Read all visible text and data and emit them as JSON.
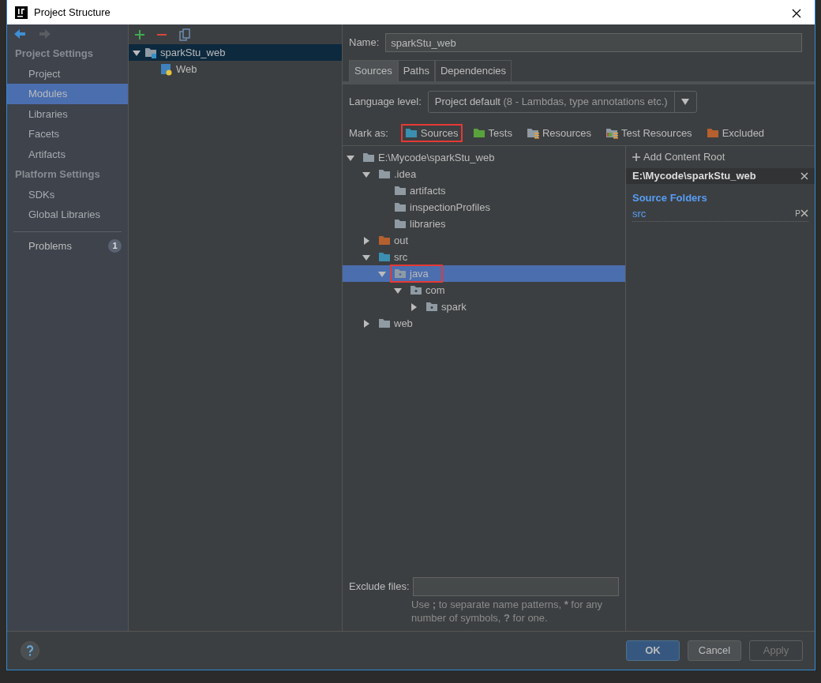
{
  "window": {
    "title": "Project Structure"
  },
  "sidebar": {
    "sections": [
      {
        "heading": "Project Settings",
        "items": [
          {
            "label": "Project",
            "selected": false
          },
          {
            "label": "Modules",
            "selected": true
          },
          {
            "label": "Libraries",
            "selected": false
          },
          {
            "label": "Facets",
            "selected": false
          },
          {
            "label": "Artifacts",
            "selected": false
          }
        ]
      },
      {
        "heading": "Platform Settings",
        "items": [
          {
            "label": "SDKs",
            "selected": false
          },
          {
            "label": "Global Libraries",
            "selected": false
          }
        ]
      }
    ],
    "problems": {
      "label": "Problems",
      "count": "1"
    }
  },
  "modules": {
    "items": [
      {
        "label": "sparkStu_web",
        "selected": true,
        "expanded": true,
        "children": [
          {
            "label": "Web",
            "selected": false
          }
        ]
      }
    ]
  },
  "name_field": {
    "label": "Name:",
    "value": "sparkStu_web"
  },
  "tabs": [
    {
      "label": "Sources",
      "selected": true
    },
    {
      "label": "Paths",
      "selected": false
    },
    {
      "label": "Dependencies",
      "selected": false
    }
  ],
  "language_level": {
    "label": "Language level:",
    "value": "Project default",
    "hint": "(8 - Lambdas, type annotations etc.)"
  },
  "mark_as": {
    "label": "Mark as:",
    "items": [
      {
        "label": "Sources",
        "kind": "sources",
        "annotated": true
      },
      {
        "label": "Tests",
        "kind": "tests",
        "annotated": false
      },
      {
        "label": "Resources",
        "kind": "resources",
        "annotated": false
      },
      {
        "label": "Test Resources",
        "kind": "testresources",
        "annotated": false
      },
      {
        "label": "Excluded",
        "kind": "excluded",
        "annotated": false
      }
    ]
  },
  "tree": [
    {
      "label": "E:\\Mycode\\sparkStu_web",
      "kind": "plain",
      "expanded": true,
      "selected": false,
      "annotated": false,
      "children": [
        {
          "label": ".idea",
          "kind": "plain",
          "expanded": true,
          "selected": false,
          "annotated": false,
          "children": [
            {
              "label": "artifacts",
              "kind": "plain",
              "selected": false,
              "annotated": false
            },
            {
              "label": "inspectionProfiles",
              "kind": "plain",
              "selected": false,
              "annotated": false
            },
            {
              "label": "libraries",
              "kind": "plain",
              "selected": false,
              "annotated": false
            }
          ]
        },
        {
          "label": "out",
          "kind": "excluded",
          "expanded": false,
          "selected": false,
          "annotated": false
        },
        {
          "label": "src",
          "kind": "sources",
          "expanded": true,
          "selected": false,
          "annotated": false,
          "children": [
            {
              "label": "java",
              "kind": "package",
              "expanded": true,
              "selected": true,
              "annotated": true,
              "children": [
                {
                  "label": "com",
                  "kind": "package",
                  "expanded": true,
                  "selected": false,
                  "annotated": false,
                  "children": [
                    {
                      "label": "spark",
                      "kind": "package",
                      "expanded": false,
                      "selected": false,
                      "annotated": false
                    }
                  ]
                }
              ]
            }
          ]
        },
        {
          "label": "web",
          "kind": "plain",
          "expanded": false,
          "selected": false,
          "annotated": false
        }
      ]
    }
  ],
  "exclude_files": {
    "label": "Exclude files:",
    "help": "Use **;** to separate name patterns, ***** for any number of symbols, **?** for one."
  },
  "content_root": {
    "add_label": "Add Content Root",
    "path": "E:\\Mycode\\sparkStu_web",
    "section": "Source Folders",
    "folders": [
      "src"
    ],
    "prefix_glyph": "P"
  },
  "buttons": [
    {
      "label": "OK",
      "kind": "default",
      "disabled": false
    },
    {
      "label": "Cancel",
      "kind": "normal",
      "disabled": false
    },
    {
      "label": "Apply",
      "kind": "normal",
      "disabled": true
    }
  ]
}
